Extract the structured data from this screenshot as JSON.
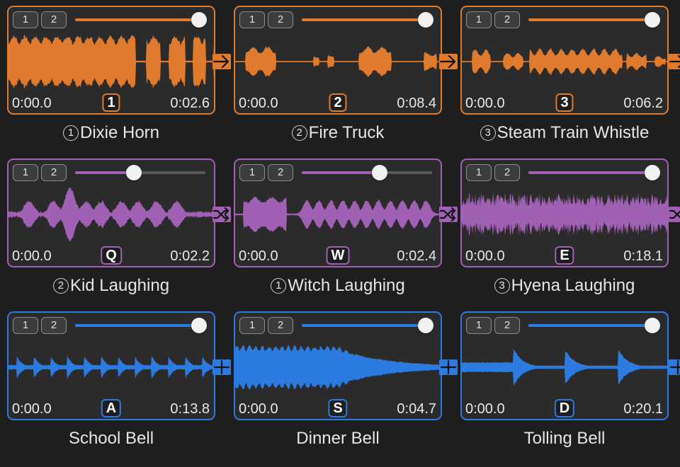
{
  "theme": {
    "orange": "#e07a2c",
    "purple": "#a060b4",
    "blue": "#2c7be0"
  },
  "badge_labels": [
    "1",
    "2"
  ],
  "rows": [
    {
      "color": "#e07a2c",
      "connector_icon": "arrow-right-icon",
      "tiles": [
        {
          "start": "0:00.0",
          "end": "0:02.6",
          "key": "1",
          "order": "①",
          "name": "Dixie Horn",
          "volume": 1.0
        },
        {
          "start": "0:00.0",
          "end": "0:08.4",
          "key": "2",
          "order": "②",
          "name": "Fire Truck",
          "volume": 1.0
        },
        {
          "start": "0:00.0",
          "end": "0:06.2",
          "key": "3",
          "order": "③",
          "name": "Steam Train Whistle",
          "volume": 1.0
        }
      ]
    },
    {
      "color": "#a060b4",
      "connector_icon": "shuffle-icon",
      "tiles": [
        {
          "start": "0:00.0",
          "end": "0:02.2",
          "key": "Q",
          "order": "②",
          "name": "Kid Laughing",
          "volume": 0.45
        },
        {
          "start": "0:00.0",
          "end": "0:02.4",
          "key": "W",
          "order": "①",
          "name": "Witch Laughing",
          "volume": 0.6
        },
        {
          "start": "0:00.0",
          "end": "0:18.1",
          "key": "E",
          "order": "③",
          "name": "Hyena Laughing",
          "volume": 1.0
        }
      ]
    },
    {
      "color": "#2c7be0",
      "connector_icon": "plus-icon",
      "tiles": [
        {
          "start": "0:00.0",
          "end": "0:13.8",
          "key": "A",
          "order": "",
          "name": "School Bell",
          "volume": 1.0
        },
        {
          "start": "0:00.0",
          "end": "0:04.7",
          "key": "S",
          "order": "",
          "name": "Dinner Bell",
          "volume": 1.0
        },
        {
          "start": "0:00.0",
          "end": "0:20.1",
          "key": "D",
          "order": "",
          "name": "Tolling Bell",
          "volume": 1.0
        }
      ]
    }
  ]
}
